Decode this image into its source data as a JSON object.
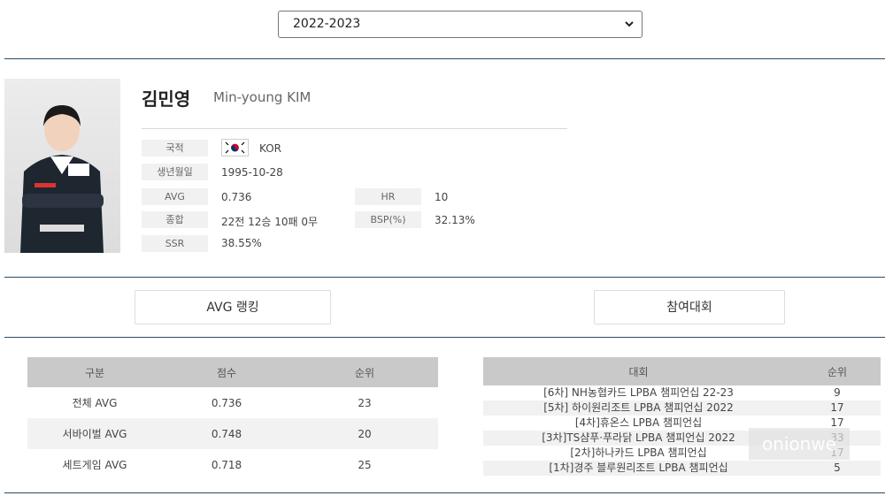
{
  "season": {
    "selected": "2022-2023"
  },
  "player": {
    "name_ko": "김민영",
    "name_en": "Min-young KIM",
    "nationality_label": "국적",
    "nationality": "KOR",
    "birth_label": "생년월일",
    "birth": "1995-10-28",
    "avg_label": "AVG",
    "avg": "0.736",
    "hr_label": "HR",
    "hr": "10",
    "record_label": "종합",
    "record": "22전 12승 10패 0무",
    "bsp_label": "BSP(%)",
    "bsp": "32.13%",
    "ssr_label": "SSR",
    "ssr": "38.55%"
  },
  "tabs": {
    "avg_ranking": "AVG 랭킹",
    "tournaments": "참여대회"
  },
  "ranking_table": {
    "headers": [
      "구분",
      "점수",
      "순위"
    ],
    "rows": [
      {
        "category": "전체 AVG",
        "score": "0.736",
        "rank": "23"
      },
      {
        "category": "서바이벌 AVG",
        "score": "0.748",
        "rank": "20"
      },
      {
        "category": "세트게임 AVG",
        "score": "0.718",
        "rank": "25"
      }
    ]
  },
  "tournament_table": {
    "headers": [
      "대회",
      "순위"
    ],
    "rows": [
      {
        "name": "[6차] NH농협카드 LPBA 챔피언십 22-23",
        "rank": "9"
      },
      {
        "name": "[5차] 하이원리조트 LPBA 챔피언십 2022",
        "rank": "17"
      },
      {
        "name": "[4차]휴온스 LPBA 챔피언십",
        "rank": "17"
      },
      {
        "name": "[3차]TS샴푸·푸라닭 LPBA 챔피언십 2022",
        "rank": "33"
      },
      {
        "name": "[2차]하나카드 LPBA 챔피언십",
        "rank": "17"
      },
      {
        "name": "[1차]경주 블루원리조트 LPBA 챔피언십",
        "rank": "5"
      }
    ]
  },
  "watermark": "onionwe",
  "colors": {
    "rule": "#2a4a6a",
    "table_header": "#c9c9c9",
    "label_bg": "#f1f1f1"
  }
}
